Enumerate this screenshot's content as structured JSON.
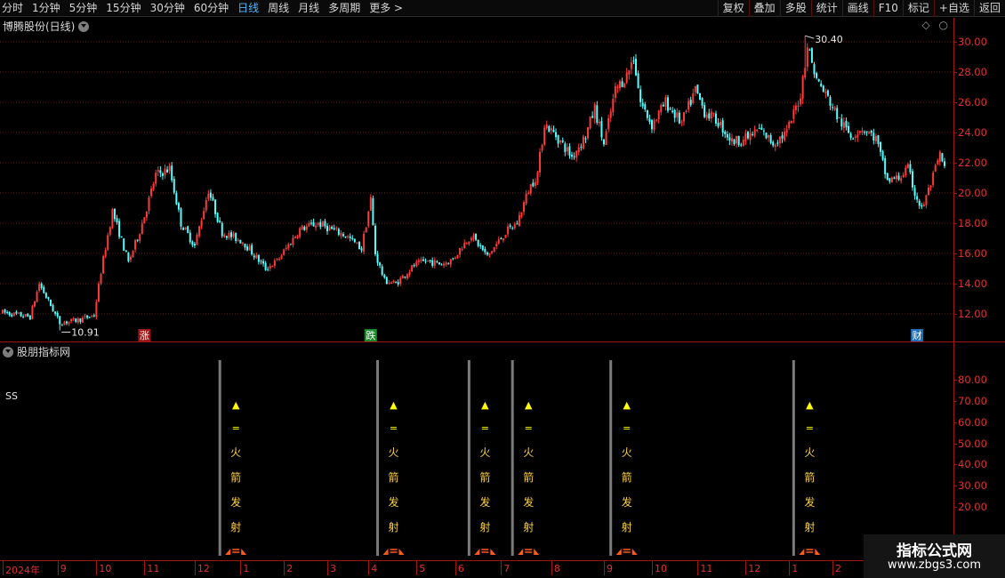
{
  "toolbar": {
    "periods": [
      {
        "label": "分时"
      },
      {
        "label": "1分钟"
      },
      {
        "label": "5分钟"
      },
      {
        "label": "15分钟"
      },
      {
        "label": "30分钟"
      },
      {
        "label": "60分钟"
      },
      {
        "label": "日线",
        "active": true
      },
      {
        "label": "周线"
      },
      {
        "label": "月线"
      },
      {
        "label": "多周期"
      },
      {
        "label": "更多 >"
      }
    ],
    "actions": [
      "复权",
      "叠加",
      "多股",
      "统计",
      "画线",
      "F10",
      "标记",
      "+自选",
      "返回"
    ]
  },
  "main_panel": {
    "title": "博腾股份(日线)"
  },
  "indicator_panel": {
    "title": "股朋指标网",
    "label": "SS"
  },
  "watermark": {
    "line1": "指标公式网",
    "line2": "www.zbgs3.com"
  },
  "colors": {
    "up": "#ff3a3a",
    "down": "#54ffff",
    "axis": "#a01414",
    "signal_text": "#ffd23a",
    "signal_head": "#ffff00"
  },
  "chart_data": [
    {
      "type": "candlestick",
      "ylim": [
        10.5,
        31.2
      ],
      "yticks": [
        "12.00",
        "14.00",
        "16.00",
        "18.00",
        "20.00",
        "22.00",
        "24.00",
        "26.00",
        "28.00",
        "30.00"
      ],
      "x_labels": [
        "2024年",
        "9",
        "10",
        "11",
        "12",
        "1",
        "2",
        "3",
        "4",
        "5",
        "6",
        "7",
        "8",
        "9",
        "10",
        "11",
        "12",
        "1",
        "2"
      ],
      "x_label_day": [
        0,
        24,
        41,
        62,
        84,
        104,
        123,
        142,
        160,
        181,
        198,
        218,
        240,
        263,
        284,
        304,
        325,
        344,
        363
      ],
      "max_label": "30.40",
      "max_label_day": 351,
      "max_value": 30.4,
      "min_label": "10.91",
      "min_label_day": 25,
      "min_value": 10.91,
      "markers": [
        {
          "text": "涨",
          "day": 62
        },
        {
          "text": "跌",
          "day": 161
        },
        {
          "text": "财",
          "day": 400
        }
      ],
      "anchors": [
        [
          0,
          12.1
        ],
        [
          12,
          11.8
        ],
        [
          16,
          14.0
        ],
        [
          25,
          11.4
        ],
        [
          33,
          11.6
        ],
        [
          40,
          11.9
        ],
        [
          43,
          14.8
        ],
        [
          48,
          18.8
        ],
        [
          55,
          15.4
        ],
        [
          60,
          17.5
        ],
        [
          63,
          19.0
        ],
        [
          67,
          21.2
        ],
        [
          73,
          21.6
        ],
        [
          78,
          18.0
        ],
        [
          84,
          16.5
        ],
        [
          90,
          20.2
        ],
        [
          96,
          17.4
        ],
        [
          105,
          16.8
        ],
        [
          115,
          15.0
        ],
        [
          120,
          15.5
        ],
        [
          130,
          17.6
        ],
        [
          138,
          18.0
        ],
        [
          145,
          17.5
        ],
        [
          150,
          17.2
        ],
        [
          157,
          16.3
        ],
        [
          161,
          19.6
        ],
        [
          163,
          16.0
        ],
        [
          167,
          14.2
        ],
        [
          172,
          14.0
        ],
        [
          180,
          15.2
        ],
        [
          185,
          15.5
        ],
        [
          192,
          15.3
        ],
        [
          197,
          15.6
        ],
        [
          201,
          16.5
        ],
        [
          205,
          17.2
        ],
        [
          212,
          15.8
        ],
        [
          220,
          17.4
        ],
        [
          225,
          18.0
        ],
        [
          230,
          20.2
        ],
        [
          234,
          21.3
        ],
        [
          237,
          24.6
        ],
        [
          242,
          23.8
        ],
        [
          249,
          22.4
        ],
        [
          255,
          23.8
        ],
        [
          259,
          25.6
        ],
        [
          263,
          23.2
        ],
        [
          268,
          26.8
        ],
        [
          273,
          27.8
        ],
        [
          276,
          29.0
        ],
        [
          279,
          26.0
        ],
        [
          284,
          24.5
        ],
        [
          290,
          26.0
        ],
        [
          297,
          24.6
        ],
        [
          303,
          26.8
        ],
        [
          307,
          25.4
        ],
        [
          313,
          24.7
        ],
        [
          319,
          23.4
        ],
        [
          325,
          23.6
        ],
        [
          331,
          24.2
        ],
        [
          337,
          23.3
        ],
        [
          343,
          24.0
        ],
        [
          349,
          26.5
        ],
        [
          352,
          29.8
        ],
        [
          356,
          27.5
        ],
        [
          362,
          26.0
        ],
        [
          366,
          24.8
        ],
        [
          371,
          23.8
        ],
        [
          376,
          24.3
        ],
        [
          382,
          23.6
        ],
        [
          387,
          20.8
        ],
        [
          392,
          21.0
        ],
        [
          396,
          21.6
        ],
        [
          399,
          20.0
        ],
        [
          402,
          18.9
        ],
        [
          406,
          20.6
        ],
        [
          410,
          22.5
        ],
        [
          412,
          21.6
        ]
      ]
    },
    {
      "type": "signal",
      "ylim": [
        11,
        92
      ],
      "yticks": [
        "20.00",
        "30.00",
        "40.00",
        "50.00",
        "60.00",
        "70.00",
        "80.00"
      ],
      "signals": [
        {
          "day": 95,
          "text": [
            "▲",
            "=",
            "火",
            "箭",
            "发",
            "射"
          ]
        },
        {
          "day": 164,
          "text": [
            "▲",
            "=",
            "火",
            "箭",
            "发",
            "射"
          ]
        },
        {
          "day": 204,
          "text": [
            "▲",
            "=",
            "火",
            "箭",
            "发",
            "射"
          ]
        },
        {
          "day": 223,
          "text": [
            "▲",
            "=",
            "火",
            "箭",
            "发",
            "射"
          ]
        },
        {
          "day": 266,
          "text": [
            "▲",
            "=",
            "火",
            "箭",
            "发",
            "射"
          ]
        },
        {
          "day": 346,
          "text": [
            "▲",
            "=",
            "火",
            "箭",
            "发",
            "射"
          ]
        }
      ]
    }
  ]
}
